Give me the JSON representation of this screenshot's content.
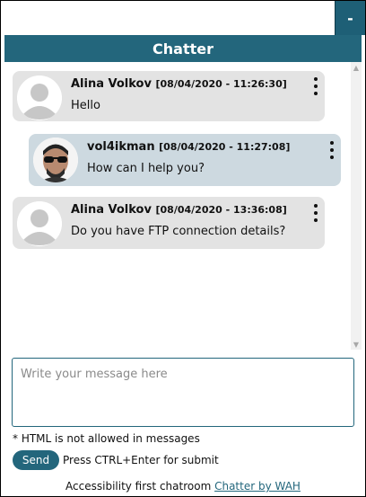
{
  "window": {
    "minimize_label": "-"
  },
  "header": {
    "title": "Chatter"
  },
  "messages": [
    {
      "author": "Alina Volkov",
      "timestamp": "[08/04/2020 - 11:26:30]",
      "text": "Hello",
      "avatar": "default-avatar-icon"
    },
    {
      "author": "vol4ikman",
      "timestamp": "[08/04/2020 - 11:27:08]",
      "text": "How can I help you?",
      "avatar": "user-photo"
    },
    {
      "author": "Alina Volkov",
      "timestamp": "[08/04/2020 - 13:36:08]",
      "text": "Do you have FTP connection details?",
      "avatar": "default-avatar-icon"
    }
  ],
  "composer": {
    "placeholder": "Write your message here",
    "value": "",
    "note": "* HTML is not allowed in messages",
    "send_label": "Send",
    "hint": "Press CTRL+Enter for submit"
  },
  "footer": {
    "text": "Accessibility first chatroom",
    "link_label": "Chatter by WAH"
  },
  "colors": {
    "accent": "#23667c",
    "bubble": "#e3e3e3",
    "own_bubble": "#cdd9e0"
  }
}
